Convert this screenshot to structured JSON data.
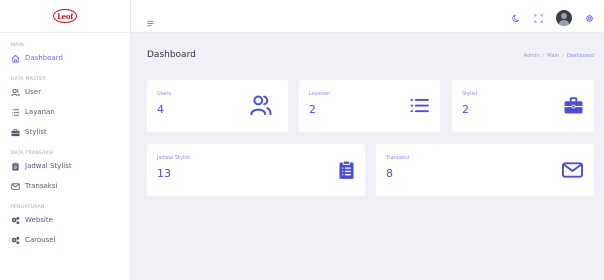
{
  "brand": {
    "logo_text": "Leof",
    "color": "#c0141c"
  },
  "theme": {
    "accent": "#6a6ef0",
    "value_color": "#4b4fd8"
  },
  "sidebar": {
    "sections": [
      {
        "title": "MAIN",
        "items": [
          {
            "label": "Dashboard",
            "icon": "home-icon",
            "active": true
          }
        ]
      },
      {
        "title": "DATA MASTER",
        "items": [
          {
            "label": "User",
            "icon": "users-icon"
          },
          {
            "label": "Layanan",
            "icon": "list-icon"
          },
          {
            "label": "Stylist",
            "icon": "briefcase-icon"
          }
        ]
      },
      {
        "title": "DATA TRANSAKSI",
        "items": [
          {
            "label": "Jadwal Stylist",
            "icon": "clipboard-icon"
          },
          {
            "label": "Transaksi",
            "icon": "mail-icon"
          }
        ]
      },
      {
        "title": "PENGATURAN",
        "items": [
          {
            "label": "Website",
            "icon": "cogs-icon"
          },
          {
            "label": "Carousel",
            "icon": "cogs-icon"
          }
        ]
      }
    ]
  },
  "topbar": {
    "icons": [
      "moon-icon",
      "fullscreen-icon",
      "avatar",
      "gear-icon"
    ]
  },
  "page": {
    "title": "Dashboard",
    "breadcrumb": [
      "Admin",
      "Main",
      "Dashboard"
    ],
    "breadcrumb_sep": "/"
  },
  "cards": {
    "users": {
      "label": "Users",
      "value": "4",
      "icon": "users-icon"
    },
    "layanan": {
      "label": "Layanan",
      "value": "2",
      "icon": "list-icon"
    },
    "stylist": {
      "label": "Stylist",
      "value": "2",
      "icon": "briefcase-icon"
    },
    "jadwal": {
      "label": "Jadwal Stylist",
      "value": "13",
      "icon": "clipboard-icon"
    },
    "transaksi": {
      "label": "Transaksi",
      "value": "8",
      "icon": "mail-icon"
    }
  }
}
